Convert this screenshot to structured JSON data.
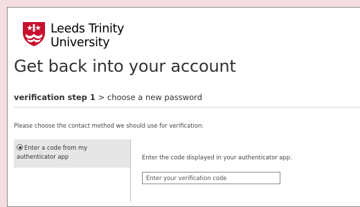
{
  "brand": {
    "name_line1": "Leeds Trinity",
    "name_line2": "University",
    "logo_icon": "university-crest-icon",
    "colors": {
      "shield": "#c8102e",
      "page_bg": "#f4dde0"
    }
  },
  "page": {
    "title": "Get back into your account"
  },
  "steps": {
    "current": "verification step 1",
    "separator": ">",
    "next": "choose a new password"
  },
  "instructions": "Please choose the contact method we should use for verification:",
  "methods": {
    "options": [
      {
        "label": "Enter a code from my authenticator app",
        "selected": true
      }
    ]
  },
  "detail": {
    "text": "Enter the code displayed in your authenticator app.",
    "input_placeholder": "Enter your verification code",
    "input_value": ""
  }
}
